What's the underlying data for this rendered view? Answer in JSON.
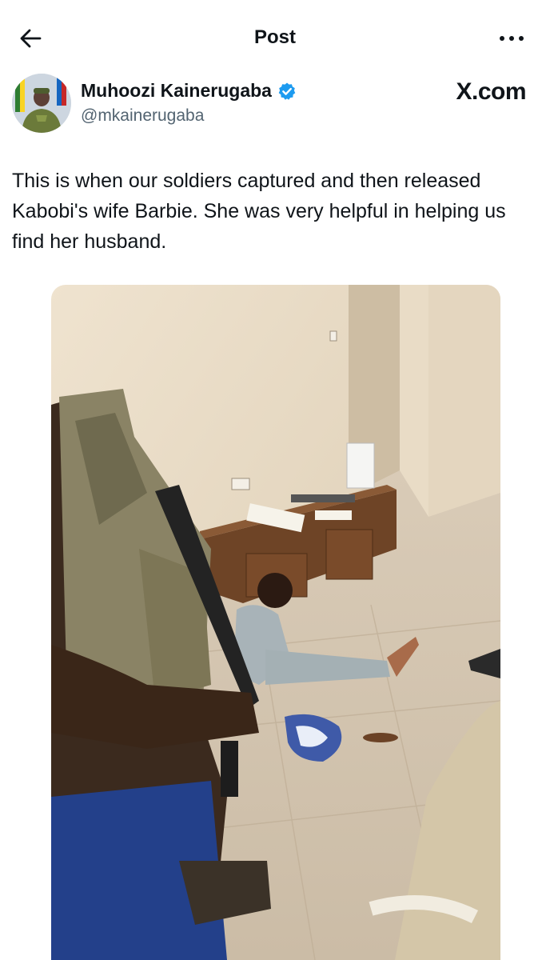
{
  "header": {
    "title": "Post",
    "back_icon": "arrow-left-icon",
    "more_icon": "more-horizontal-icon"
  },
  "author": {
    "name": "Muhoozi Kainerugaba",
    "handle": "@mkainerugaba",
    "verified": true,
    "verified_color": "#1d9bf0"
  },
  "watermark": "X.com",
  "post": {
    "text": "This is when our soldiers captured and then released Kabobi's wife Barbie. She was very helpful in helping us find her husband."
  },
  "media": {
    "type": "photo",
    "content": "soldier with rifle standing in living room, woman sitting on tiled floor"
  },
  "colors": {
    "text": "#0f1419",
    "secondary_text": "#536471",
    "background": "#ffffff"
  }
}
